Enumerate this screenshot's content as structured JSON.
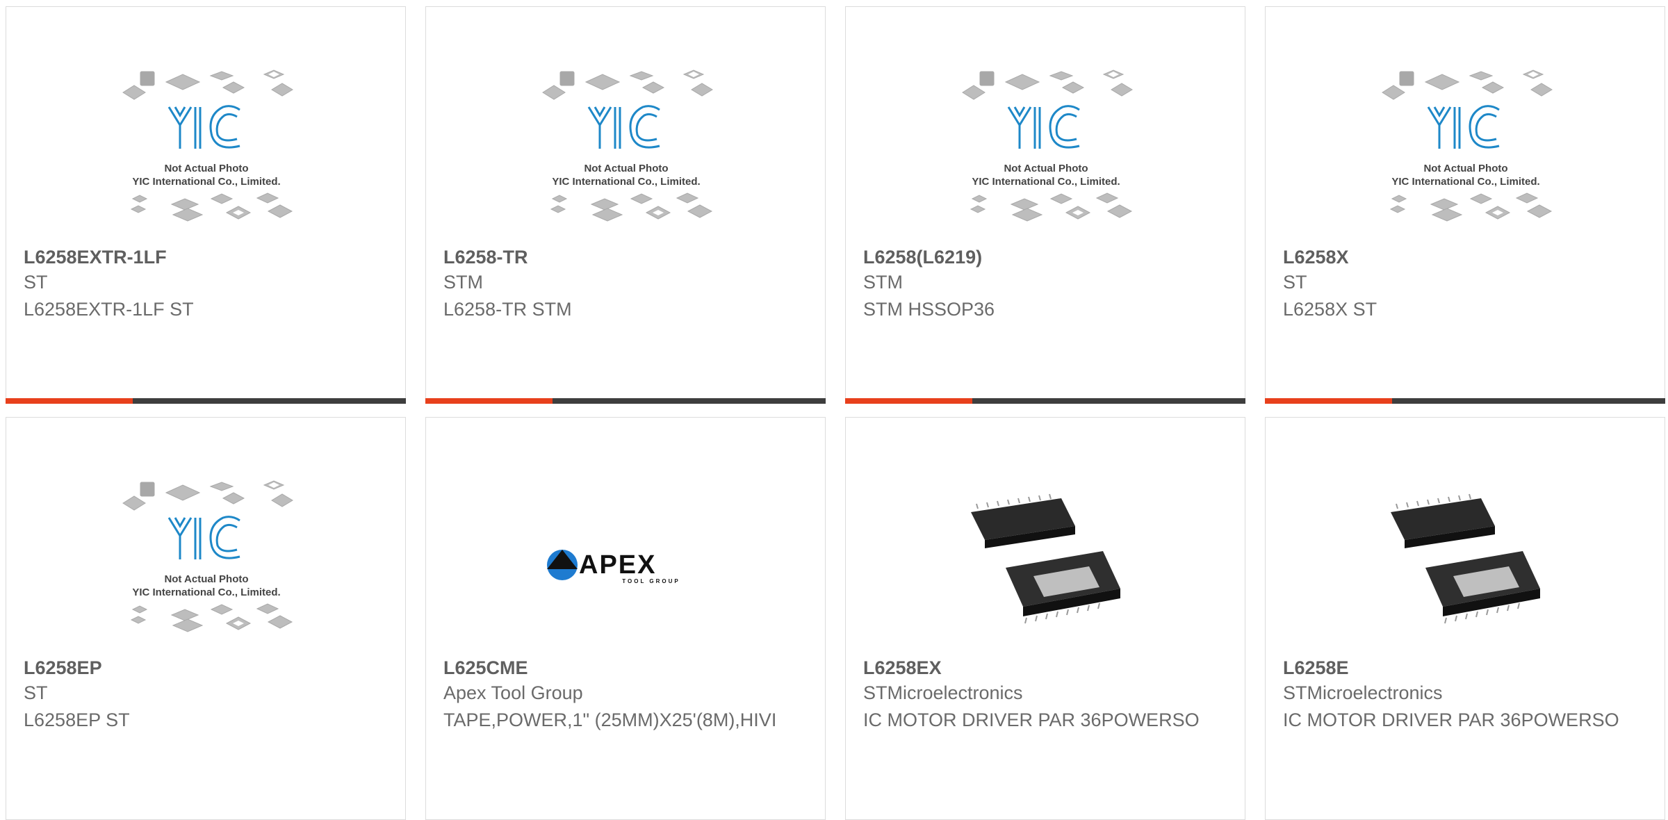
{
  "products": [
    {
      "part": "L6258EXTR-1LF",
      "manufacturer": "ST",
      "description": "L6258EXTR-1LF ST",
      "image": "yic-not-actual-photo"
    },
    {
      "part": "L6258-TR",
      "manufacturer": "STM",
      "description": "L6258-TR STM",
      "image": "yic-not-actual-photo"
    },
    {
      "part": "L6258(L6219)",
      "manufacturer": "STM",
      "description": "STM HSSOP36",
      "image": "yic-not-actual-photo"
    },
    {
      "part": "L6258X",
      "manufacturer": "ST",
      "description": "L6258X ST",
      "image": "yic-not-actual-photo"
    },
    {
      "part": "L6258EP",
      "manufacturer": "ST",
      "description": "L6258EP ST",
      "image": "yic-not-actual-photo"
    },
    {
      "part": "L625CME",
      "manufacturer": "Apex Tool Group",
      "description": "TAPE,POWER,1\" (25MM)X25'(8M),HIVI",
      "image": "apex-tool-group-logo"
    },
    {
      "part": "L6258EX",
      "manufacturer": "STMicroelectronics",
      "description": "IC MOTOR DRIVER PAR 36POWERSO",
      "image": "powerso36-package-photo"
    },
    {
      "part": "L6258E",
      "manufacturer": "STMicroelectronics",
      "description": "IC MOTOR DRIVER PAR 36POWERSO",
      "image": "powerso36-package-photo"
    }
  ],
  "placeholder_caption": {
    "logo_text": "YIC",
    "line1": "Not Actual Photo",
    "line2": "YIC International Co., Limited."
  },
  "apex_logo": {
    "wordmark": "APEX",
    "tagline": "TOOL GROUP"
  },
  "colors": {
    "accent": "#e8401c",
    "bar": "#3e3e3e",
    "yic_blue": "#1e88c8",
    "border": "#dcdcdc"
  }
}
